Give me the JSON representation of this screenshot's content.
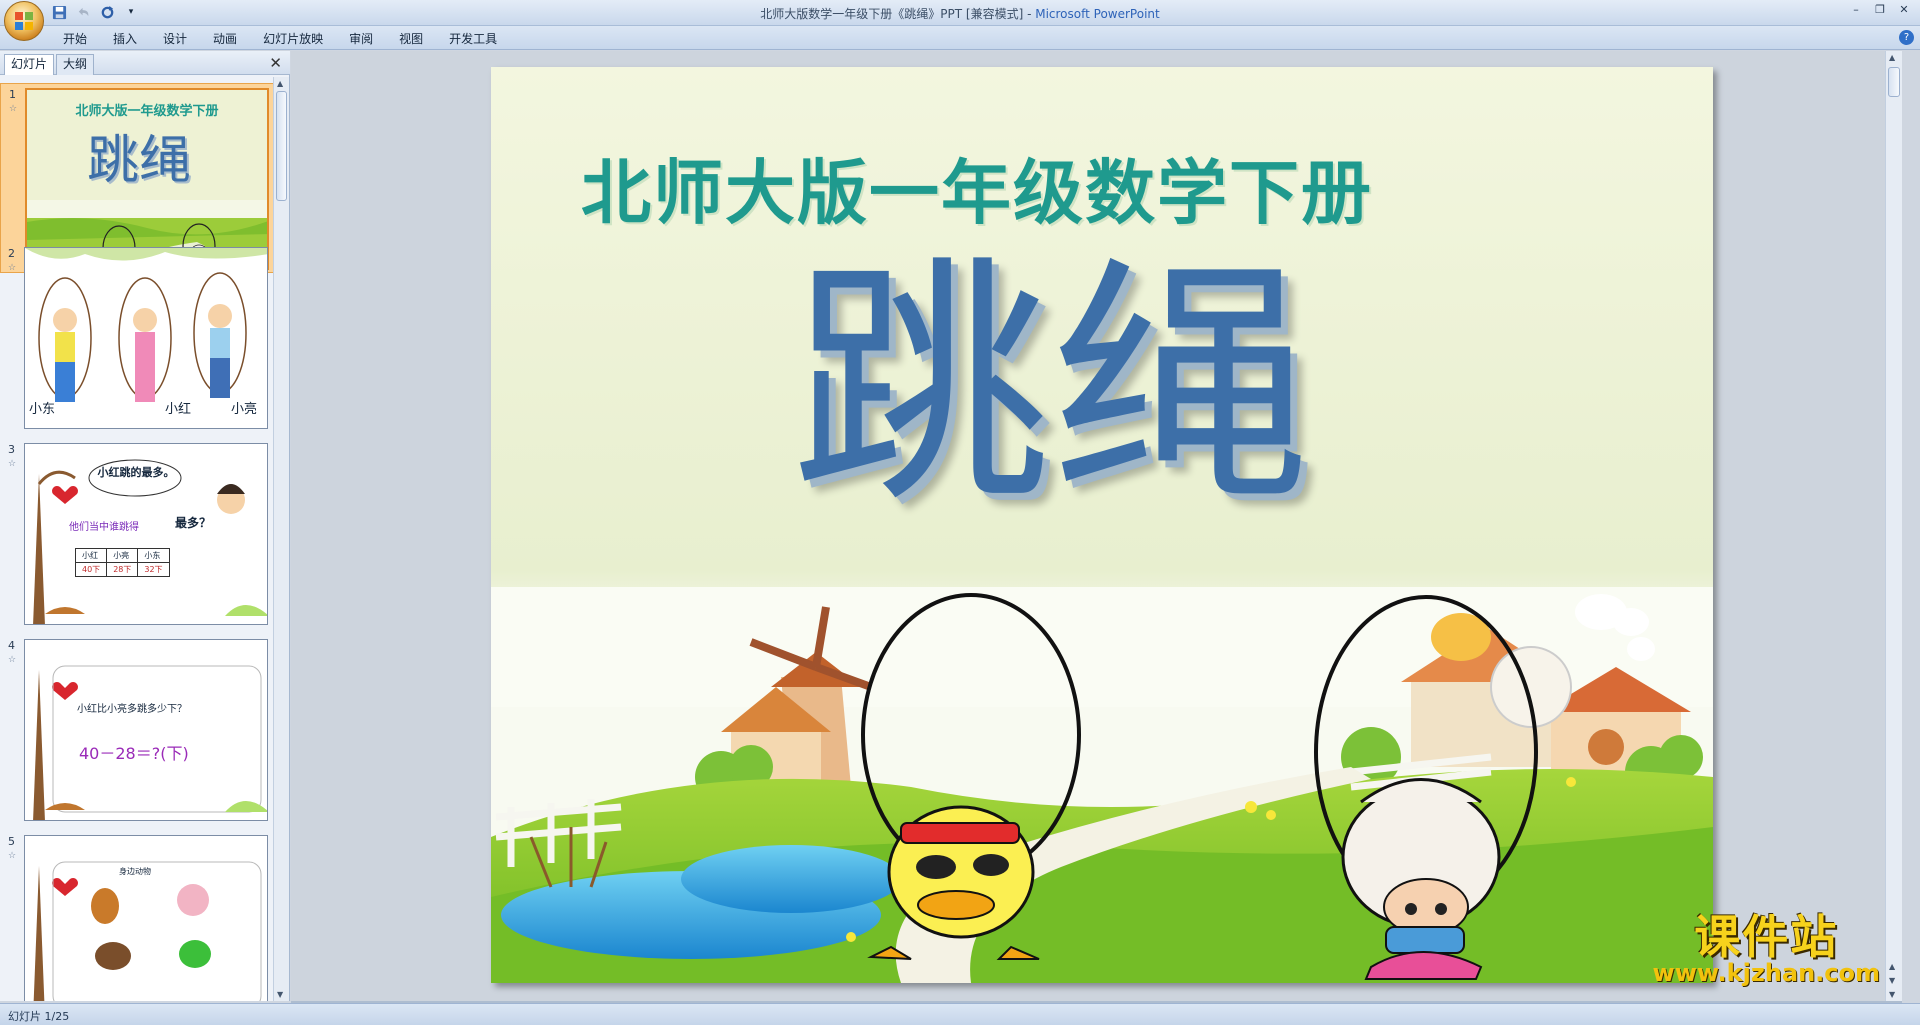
{
  "window": {
    "title": "北师大版数学一年级下册《跳绳》PPT [兼容模式]",
    "separator": " - ",
    "app_name": "Microsoft PowerPoint",
    "controls": [
      "minimize",
      "restore",
      "close"
    ]
  },
  "quick_access": [
    {
      "icon": "save-icon"
    },
    {
      "icon": "undo-icon"
    },
    {
      "icon": "redo-icon"
    },
    {
      "icon": "customize-dropdown-icon"
    }
  ],
  "ribbon": {
    "tabs": [
      "开始",
      "插入",
      "设计",
      "动画",
      "幻灯片放映",
      "审阅",
      "视图",
      "开发工具"
    ],
    "help_icon": "help-icon"
  },
  "left_pane": {
    "tabs": [
      "幻灯片",
      "大纲"
    ],
    "active_tab": "幻灯片",
    "thumbnails": [
      {
        "number": "1",
        "selected": true,
        "title": "北师大版一年级数学下册",
        "big": "跳绳"
      },
      {
        "number": "2",
        "selected": false,
        "names": [
          "小东",
          "小红",
          "小亮"
        ]
      },
      {
        "number": "3",
        "selected": false,
        "bubble": "小红跳的最多。",
        "question": "他们当中谁跳得",
        "question_tail": "最多？",
        "table_headers": [
          "小红",
          "小亮",
          "小东"
        ],
        "table_values": [
          "40下",
          "28下",
          "32下"
        ]
      },
      {
        "number": "4",
        "selected": false,
        "question": "小红比小亮多跳多少下？",
        "equation": "40－28＝?(下)"
      },
      {
        "number": "5",
        "selected": false,
        "caption": "身边动物"
      }
    ]
  },
  "slide": {
    "subtitle": "北师大版一年级数学下册",
    "title": "跳绳"
  },
  "watermark": {
    "title": "课件站",
    "url": "www.kjzhan.com"
  },
  "status": {
    "text": "幻灯片 1/25"
  },
  "colors": {
    "subtitle": "#1f9a8e",
    "title": "#3d6fa8",
    "selection": "#fcd49a"
  }
}
